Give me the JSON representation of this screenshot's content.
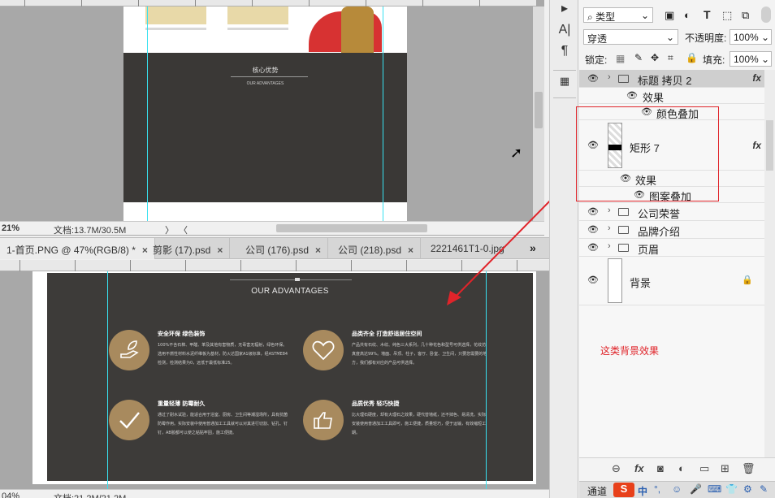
{
  "top_document": {
    "section_title": "核心优势",
    "section_subtitle": "OUR ADVANTAGES",
    "zoom": "21%",
    "doc_info": "文档:13.7M/30.5M",
    "status_arrow": "〉",
    "scroll_left": "〈"
  },
  "tabs": [
    {
      "label": "1-首页.PNG @ 47%(RGB/8) *",
      "close": "×"
    },
    {
      "label": "剪影 (17).psd",
      "close": "×"
    },
    {
      "label": "公司 (176).psd",
      "close": "×"
    },
    {
      "label": "公司 (218).psd",
      "close": "×"
    },
    {
      "label": "2221461T1-0.jpg",
      "close": ""
    }
  ],
  "tabs_overflow": "»",
  "bottom_document": {
    "section_subtitle": "OUR ADVANTAGES",
    "zoom": "04%",
    "doc_info": "文档:21.2M/21.2M",
    "features": [
      {
        "icon": "hand-leaf-icon",
        "heading": "安全环保 绿色装饰",
        "text": "100%不含石棉、甲醛、苯及其他有害物质，无毒害无辐射，绿色环保。选用不燃性材料水泥纤维板为基材，防火达国家A1级标准，经ASTME84检测，检测结果为0，远低于最低标准25。"
      },
      {
        "icon": "heart-icon",
        "heading": "品类齐全 打造舒适居住空间",
        "text": "产品共有石纹、木纹、纯色三大系列，几十种花色和型号可供选择，花纹仿真度高达99%。墙面、吊顶、柱子，客厅、卧室、卫生间，只要您需要的地方，我们都有对应的产品可供选择。"
      },
      {
        "icon": "check-icon",
        "heading": "重量轻薄 防霉耐久",
        "text": "通过了耐水试验，能适合用于浴室、厨房、卫生间等潮湿场所，具有抗菌防霉作用。实际安装中使用普通加工工具就可以对其进行切割、钻孔、钉钉，AB胶都可以使之粘贴牢固，施工便捷。"
      },
      {
        "icon": "thumbs-up-icon",
        "heading": "品质优秀 轻巧快捷",
        "text": "比大理石硬度，却有大理石之效果，硬代替墙纸，还不掉色、易清洗。实际安装使用普通加工工具即可，施工便捷，质量轻巧，便于运输，有效缩短工期。"
      }
    ]
  },
  "layers_panel": {
    "filter_kind": "类型",
    "blend_mode": "穿透",
    "opacity_label": "不透明度:",
    "opacity_value": "100%",
    "lock_label": "锁定:",
    "fill_label": "填充:",
    "fill_value": "100%",
    "layers": [
      {
        "name": "标题 拷贝 2",
        "type": "group",
        "fx": "fx"
      },
      {
        "name": "效果",
        "type": "effects"
      },
      {
        "name": "颜色叠加",
        "type": "effect"
      },
      {
        "name": "矩形 7",
        "type": "shape",
        "fx": "fx"
      },
      {
        "name": "效果",
        "type": "effects"
      },
      {
        "name": "图案叠加",
        "type": "effect"
      },
      {
        "name": "公司荣誉",
        "type": "group"
      },
      {
        "name": "品牌介绍",
        "type": "group"
      },
      {
        "name": "页眉",
        "type": "group"
      },
      {
        "name": "背景",
        "type": "background"
      }
    ],
    "annotation": "这类背景效果",
    "bottom_icons": [
      "link-icon",
      "fx-icon",
      "mask-icon",
      "adjustment-icon",
      "folder-icon",
      "new-layer-icon",
      "trash-icon"
    ],
    "bottom_tab": "通道",
    "ime_label": "中",
    "fx_text": "fx"
  },
  "mini_toolbar": {
    "text_tool": "A|",
    "paragraph": "¶"
  },
  "colors": {
    "accent_guide": "#38e1f0",
    "annotation_red": "#e0242a",
    "gold_circle": "#a88a5e",
    "dark_bg": "#3a3836"
  }
}
